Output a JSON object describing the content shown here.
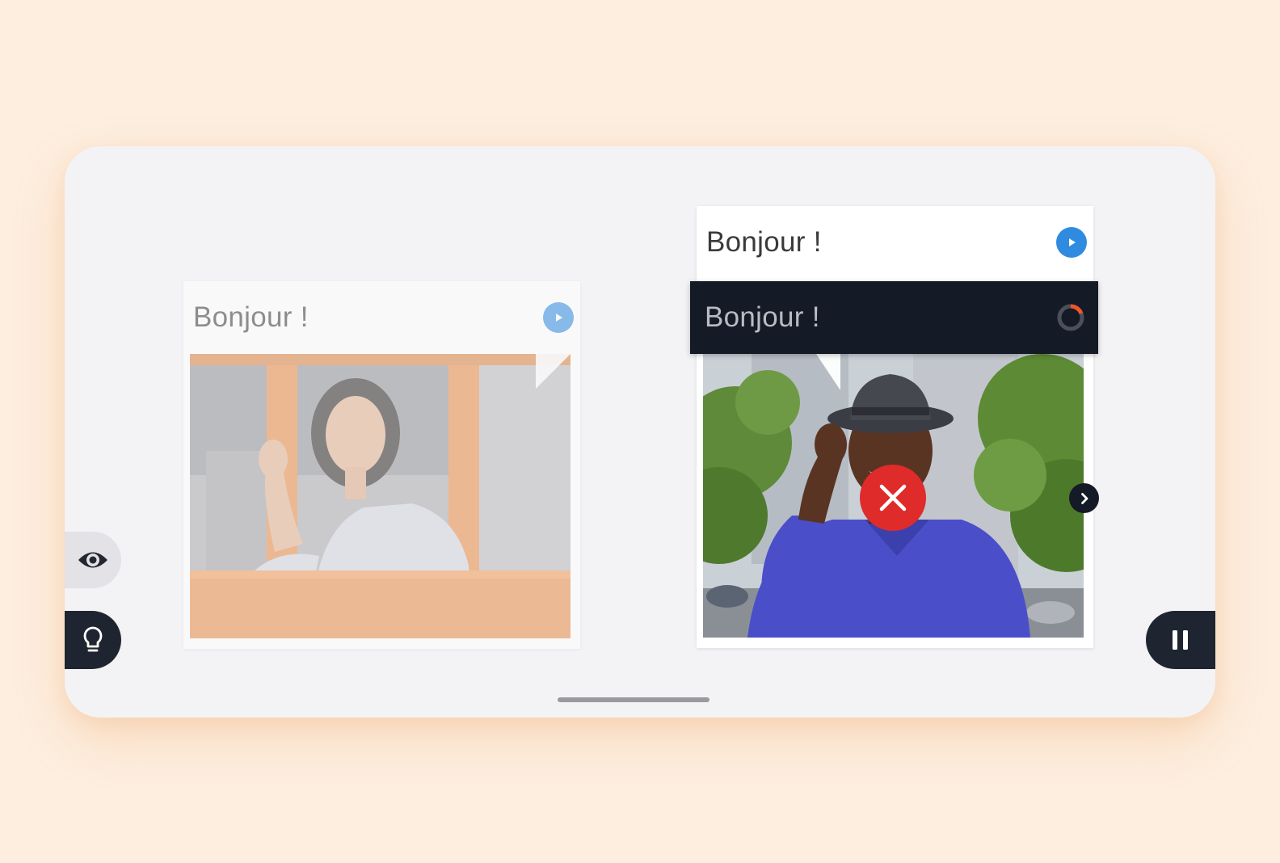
{
  "colors": {
    "background": "#fdeedf",
    "device": "#f3f2f5",
    "accent_play": "#2f8be0",
    "dark_bar": "#141a26",
    "error_red": "#e02b2b",
    "spinner_accent": "#f0552a"
  },
  "left_card": {
    "label": "Bonjour !",
    "play_icon": "play-icon",
    "photo": "woman-waving-at-window-photo"
  },
  "right_card": {
    "label": "Bonjour !",
    "play_icon": "play-icon",
    "photo": "man-in-hat-smiling-photo"
  },
  "answer_bar": {
    "label": "Bonjour !",
    "status_icon": "loading-spinner-icon"
  },
  "feedback": {
    "icon": "wrong-x-icon"
  },
  "controls": {
    "next_icon": "chevron-right-icon",
    "eye_icon": "eye-icon",
    "hint_icon": "lightbulb-icon",
    "pause_icon": "pause-icon"
  }
}
